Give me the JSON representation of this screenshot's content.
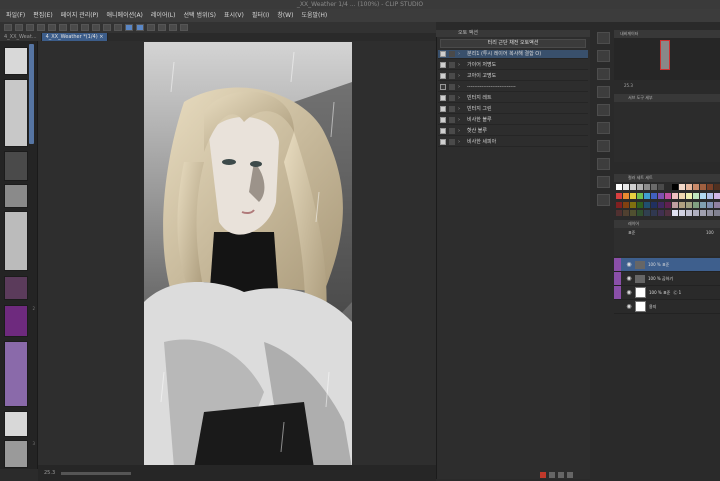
{
  "window": {
    "title": "_XX_Weather 1/4 ... (100%) - CLIP STUDIO",
    "menu": [
      "파일(F)",
      "편집(E)",
      "페이지 관리(P)",
      "애니메이션(A)",
      "레이어(L)",
      "선택 범위(S)",
      "표시(V)",
      "필터(I)",
      "창(W)",
      "도움말(H)"
    ]
  },
  "tabs": [
    {
      "label": "4_XX_Weat..."
    },
    {
      "label": "4_XX_Weather *(1/4) ×"
    }
  ],
  "navigator": {
    "page_numbers": [
      "1",
      "2",
      "3"
    ]
  },
  "statusbar": {
    "zoom": "25.3"
  },
  "auto_action": {
    "panel_title": "오토 액션",
    "selected_set": "터리 근단 채전 오토액션",
    "items": [
      {
        "label": "분리1 (투시 레이어 복사해 결합 O)",
        "checked": true,
        "selected": true
      },
      {
        "label": "가이어 저명도",
        "checked": true
      },
      {
        "label": "고아이 고명도",
        "checked": true
      },
      {
        "label": "---------------------------",
        "checked": false
      },
      {
        "label": "빈터지 레트",
        "checked": true
      },
      {
        "label": "빈터지 그린",
        "checked": true
      },
      {
        "label": "비사한 블루",
        "checked": true
      },
      {
        "label": "핫산 블루",
        "checked": true
      },
      {
        "label": "비사한 세피아",
        "checked": true
      }
    ]
  },
  "right_panels": {
    "navigator_title": "내비게이터",
    "zoom_value": "25.3",
    "subtool_title": "서브 도구 세부",
    "color_set_title": "컬러 세트 세트",
    "layer_title": "레이어",
    "blend_mode": "표준",
    "opacity": "100",
    "layers": [
      {
        "name": "100 % 표준",
        "sub": "",
        "selected": true,
        "type": "folder"
      },
      {
        "name": "100 % 곱하기",
        "sub": "",
        "selected": false,
        "type": "folder"
      },
      {
        "name": "100 % 표준",
        "sub": "Ⓒ 1",
        "selected": false,
        "type": "raster"
      },
      {
        "name": "용지",
        "sub": "",
        "selected": false,
        "type": "paper"
      }
    ]
  },
  "palette_colors": [
    "#ffffff",
    "#e8e8e8",
    "#cfcfcf",
    "#b0b0b0",
    "#8c8c8c",
    "#6a6a6a",
    "#4a4a4a",
    "#2a2a2a",
    "#000000",
    "#f2d8c9",
    "#e8b9a0",
    "#c98a6a",
    "#a06040",
    "#7a4028",
    "#503020",
    "#f0e8d8",
    "#d94040",
    "#e88a30",
    "#e8d040",
    "#70c050",
    "#40a0d0",
    "#4060c0",
    "#8050b0",
    "#c050a0",
    "#f0c0c0",
    "#f0d8b0",
    "#f0f0b0",
    "#c0e8c0",
    "#b0d8f0",
    "#b0c0e8",
    "#d0b8e8",
    "#e8b8d8",
    "#802020",
    "#804010",
    "#807010",
    "#306020",
    "#205070",
    "#203060",
    "#402860",
    "#602050",
    "#c0a0a0",
    "#b0a080",
    "#a0a080",
    "#80a080",
    "#80a0b0",
    "#8090b0",
    "#9080a0",
    "#a08090",
    "#503030",
    "#504030",
    "#505030",
    "#305030",
    "#304050",
    "#303850",
    "#403050",
    "#503040",
    "#e0e0f0",
    "#d0d0e0",
    "#c0c0d0",
    "#b0b0c0",
    "#a0a0b0",
    "#9090a0",
    "#808090",
    "#707080"
  ]
}
